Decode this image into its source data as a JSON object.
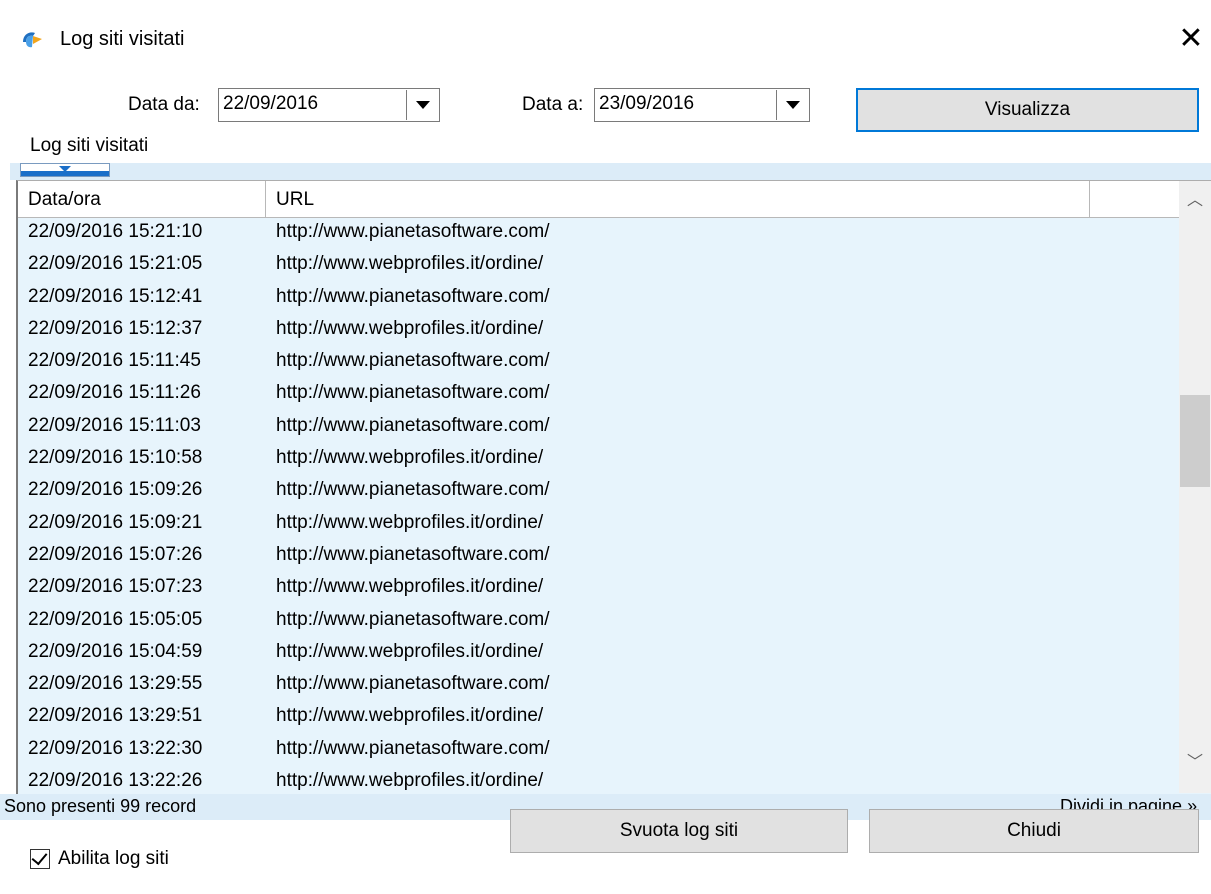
{
  "window": {
    "title": "Log siti visitati",
    "app_icon": "app-logo-icon",
    "close_glyph": "✕"
  },
  "filters": {
    "from_label": "Data da:",
    "from_value": "22/09/2016",
    "to_label": "Data a:",
    "to_value": "23/09/2016",
    "show_button": "Visualizza"
  },
  "group": {
    "label": "Log siti visitati"
  },
  "grid": {
    "columns": [
      "Data/ora",
      "URL",
      ""
    ],
    "rows": [
      {
        "datetime": "22/09/2016 15:21:10",
        "url": "http://www.pianetasoftware.com/"
      },
      {
        "datetime": "22/09/2016 15:21:05",
        "url": "http://www.webprofiles.it/ordine/"
      },
      {
        "datetime": "22/09/2016 15:12:41",
        "url": "http://www.pianetasoftware.com/"
      },
      {
        "datetime": "22/09/2016 15:12:37",
        "url": "http://www.webprofiles.it/ordine/"
      },
      {
        "datetime": "22/09/2016 15:11:45",
        "url": "http://www.pianetasoftware.com/"
      },
      {
        "datetime": "22/09/2016 15:11:26",
        "url": "http://www.pianetasoftware.com/"
      },
      {
        "datetime": "22/09/2016 15:11:03",
        "url": "http://www.pianetasoftware.com/"
      },
      {
        "datetime": "22/09/2016 15:10:58",
        "url": "http://www.webprofiles.it/ordine/"
      },
      {
        "datetime": "22/09/2016 15:09:26",
        "url": "http://www.pianetasoftware.com/"
      },
      {
        "datetime": "22/09/2016 15:09:21",
        "url": "http://www.webprofiles.it/ordine/"
      },
      {
        "datetime": "22/09/2016 15:07:26",
        "url": "http://www.pianetasoftware.com/"
      },
      {
        "datetime": "22/09/2016 15:07:23",
        "url": "http://www.webprofiles.it/ordine/"
      },
      {
        "datetime": "22/09/2016 15:05:05",
        "url": "http://www.pianetasoftware.com/"
      },
      {
        "datetime": "22/09/2016 15:04:59",
        "url": "http://www.webprofiles.it/ordine/"
      },
      {
        "datetime": "22/09/2016 13:29:55",
        "url": "http://www.pianetasoftware.com/"
      },
      {
        "datetime": "22/09/2016 13:29:51",
        "url": "http://www.webprofiles.it/ordine/"
      },
      {
        "datetime": "22/09/2016 13:22:30",
        "url": "http://www.pianetasoftware.com/"
      },
      {
        "datetime": "22/09/2016 13:22:26",
        "url": "http://www.webprofiles.it/ordine/"
      }
    ]
  },
  "status": {
    "record_count": "Sono presenti 99 record",
    "paging": "Dividi in pagine »"
  },
  "footer": {
    "enable_log_label": "Abilita log siti",
    "enable_log_checked": true,
    "clear_button": "Svuota log siti",
    "close_button": "Chiudi"
  },
  "colors": {
    "grid_background": "#e7f4fc",
    "accent": "#0078d7"
  }
}
